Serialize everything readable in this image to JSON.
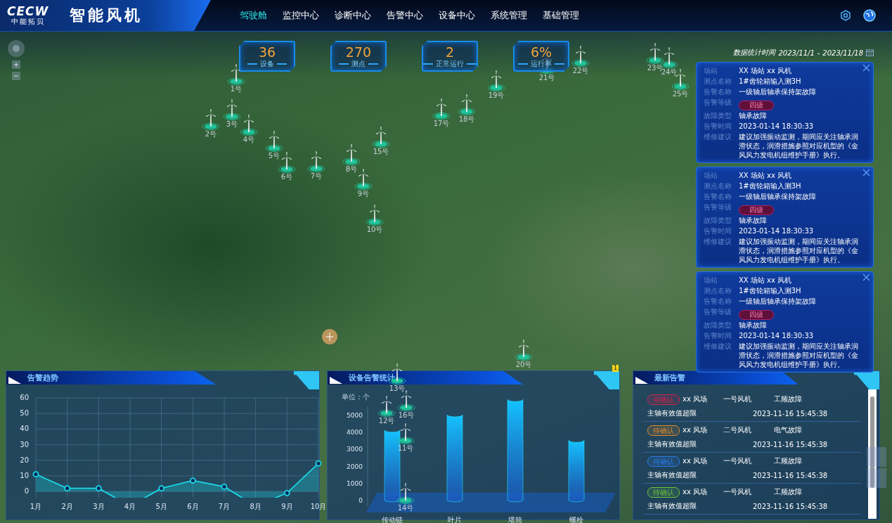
{
  "header": {
    "logo": "CECW",
    "logo_subtitle": "中能拓贝",
    "title": "智能风机",
    "nav": [
      {
        "label": "驾驶舱",
        "selected": true
      },
      {
        "label": "监控中心",
        "selected": false
      },
      {
        "label": "诊断中心",
        "selected": false
      },
      {
        "label": "告警中心",
        "selected": false
      },
      {
        "label": "设备中心",
        "selected": false
      },
      {
        "label": "系统管理",
        "selected": false
      },
      {
        "label": "基础管理",
        "selected": false
      }
    ]
  },
  "stats": [
    {
      "value": "36",
      "label": "设备"
    },
    {
      "value": "270",
      "label": "测点"
    },
    {
      "value": "2",
      "label": "正常运行"
    },
    {
      "value": "6%",
      "label": "运行率"
    }
  ],
  "stats_period": {
    "label": "数据统计时间",
    "start": "2023/11/1",
    "separator": "-",
    "end": "2023/11/18"
  },
  "map": {
    "turbines": [
      {
        "label": "1号"
      },
      {
        "label": "2号"
      },
      {
        "label": "3号"
      },
      {
        "label": "4号"
      },
      {
        "label": "5号"
      },
      {
        "label": "6号"
      },
      {
        "label": "7号"
      },
      {
        "label": "8号"
      },
      {
        "label": "9号"
      },
      {
        "label": "10号"
      },
      {
        "label": "11号"
      },
      {
        "label": "12号"
      },
      {
        "label": "13号"
      },
      {
        "label": "14号"
      },
      {
        "label": "15号"
      },
      {
        "label": "16号"
      },
      {
        "label": "17号"
      },
      {
        "label": "18号"
      },
      {
        "label": "19号"
      },
      {
        "label": "20号"
      },
      {
        "label": "21号"
      },
      {
        "label": "22号"
      },
      {
        "label": "23号"
      },
      {
        "label": "24号"
      },
      {
        "label": "25号"
      }
    ]
  },
  "alert_popups": [
    {
      "fields": [
        {
          "kind": "text",
          "label": "场站",
          "value": "XX 场站 xx 风机"
        },
        {
          "kind": "text",
          "label": "测点名称",
          "value": "1#齿轮箱输入测3H"
        },
        {
          "kind": "text",
          "label": "告警名称",
          "value": "一级轴后轴承保持架故障"
        },
        {
          "kind": "badge",
          "label": "告警等级",
          "value": "四级"
        },
        {
          "kind": "text",
          "label": "故障类型",
          "value": "轴承故障"
        },
        {
          "kind": "text",
          "label": "告警时间",
          "value": "2023-01-14 18:30:33"
        },
        {
          "kind": "text",
          "label": "维修建议",
          "value": "建议加强振动监测，期间应关注轴承润滑状态，润滑措施参照对应机型的《金风风力发电机组维护手册》执行。"
        }
      ]
    },
    {
      "fields": [
        {
          "kind": "text",
          "label": "场站",
          "value": "XX 场站 xx 风机"
        },
        {
          "kind": "text",
          "label": "测点名称",
          "value": "1#齿轮箱输入测3H"
        },
        {
          "kind": "text",
          "label": "告警名称",
          "value": "一级轴后轴承保持架故障"
        },
        {
          "kind": "badge",
          "label": "告警等级",
          "value": "四级"
        },
        {
          "kind": "text",
          "label": "故障类型",
          "value": "轴承故障"
        },
        {
          "kind": "text",
          "label": "告警时间",
          "value": "2023-01-14 18:30:33"
        },
        {
          "kind": "text",
          "label": "维修建议",
          "value": "建议加强振动监测，期间应关注轴承润滑状态，润滑措施参照对应机型的《金风风力发电机组维护手册》执行。"
        }
      ]
    },
    {
      "fields": [
        {
          "kind": "text",
          "label": "场站",
          "value": "XX 场站 xx 风机"
        },
        {
          "kind": "text",
          "label": "测点名称",
          "value": "1#齿轮箱输入测3H"
        },
        {
          "kind": "text",
          "label": "告警名称",
          "value": "一级轴后轴承保持架故障"
        },
        {
          "kind": "badge",
          "label": "告警等级",
          "value": "四级"
        },
        {
          "kind": "text",
          "label": "故障类型",
          "value": "轴承故障"
        },
        {
          "kind": "text",
          "label": "告警时间",
          "value": "2023-01-14 18:30:33"
        },
        {
          "kind": "text",
          "label": "维修建议",
          "value": "建议加强振动监测，期间应关注轴承润滑状态，润滑措施参照对应机型的《金风风力发电机组维护手册》执行。"
        }
      ]
    }
  ],
  "alarm_trend": {
    "title": "告警趋势",
    "chart_data": {
      "type": "area",
      "categories": [
        "1月",
        "2月",
        "3月",
        "4月",
        "5月",
        "6月",
        "7月",
        "8月",
        "9月",
        "10月"
      ],
      "series": [
        {
          "color": "#19d8e6",
          "values": [
            11,
            2,
            2,
            null,
            2,
            7,
            3,
            null,
            -1,
            18
          ]
        }
      ],
      "ylim": [
        -4,
        60
      ],
      "yticks": [
        0,
        10,
        20,
        30,
        40,
        50,
        60
      ],
      "grid": true
    }
  },
  "device_alarm_stats": {
    "title": "设备告警统计",
    "unit": "单位：个",
    "chart_data": {
      "type": "bar",
      "categories": [
        "传动链",
        "叶片",
        "塔筒",
        "螺栓"
      ],
      "values": [
        4100,
        5000,
        5900,
        3500
      ],
      "ylim": [
        0,
        6000
      ],
      "yticks": [
        0,
        1000,
        2000,
        3000,
        4000,
        5000
      ]
    }
  },
  "latest_alarms": {
    "title": "最新告警",
    "items": [
      {
        "status": "待确认",
        "color": "#d2244a",
        "site": "xx 风场",
        "turbine": "一号风机",
        "fault_type": "工频故障",
        "description": "主轴有效值超限",
        "time": "2023-11-16  15:45:38"
      },
      {
        "status": "待确认",
        "color": "#e08a2a",
        "site": "xx 风场",
        "turbine": "二号风机",
        "fault_type": "电气故障",
        "description": "主轴有效值超限",
        "time": "2023-11-16  15:45:38"
      },
      {
        "status": "待确认",
        "color": "#2a7de8",
        "site": "xx 风场",
        "turbine": "一号风机",
        "fault_type": "工频故障",
        "description": "主轴有效值超限",
        "time": "2023-11-16  15:45:38"
      },
      {
        "status": "待确认",
        "color": "#6cc33a",
        "site": "xx 风场",
        "turbine": "一号风机",
        "fault_type": "工频故障",
        "description": "主轴有效值超限",
        "time": "2023-11-16  15:45:38"
      }
    ]
  },
  "notification_count": "1"
}
